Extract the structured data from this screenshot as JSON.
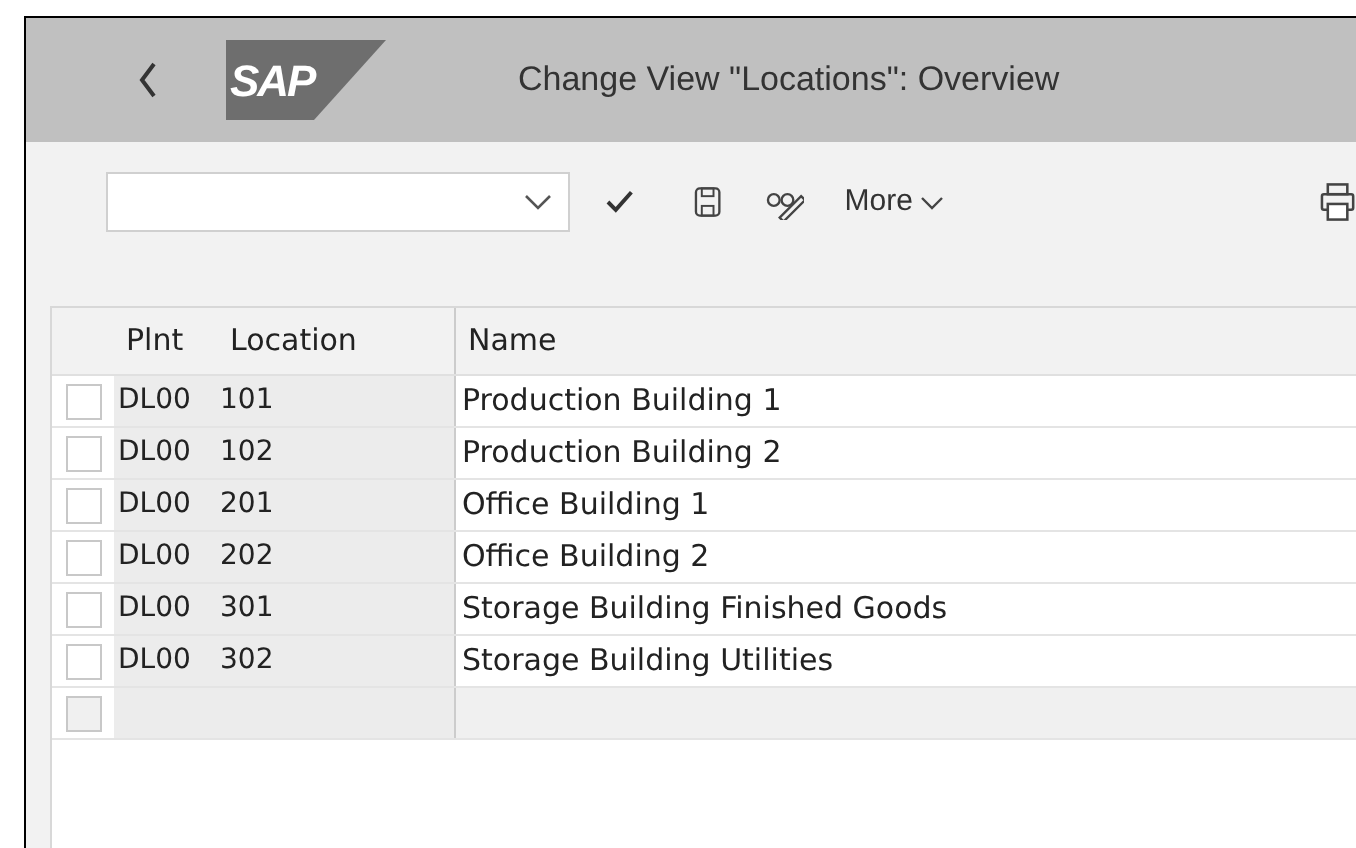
{
  "header": {
    "title": "Change View \"Locations\": Overview",
    "logo": "SAP"
  },
  "toolbar": {
    "more": "More"
  },
  "table": {
    "columns": [
      "Plnt",
      "Location",
      "Name"
    ],
    "rows": [
      {
        "plant": "DL00",
        "location": "101",
        "name": "Production Building 1",
        "checked": false
      },
      {
        "plant": "DL00",
        "location": "102",
        "name": "Production Building 2",
        "checked": false
      },
      {
        "plant": "DL00",
        "location": "201",
        "name": "Office Building 1",
        "checked": false
      },
      {
        "plant": "DL00",
        "location": "202",
        "name": "Office Building 2",
        "checked": false
      },
      {
        "plant": "DL00",
        "location": "301",
        "name": "Storage Building Finished Goods",
        "checked": false
      },
      {
        "plant": "DL00",
        "location": "302",
        "name": "Storage Building Utilities",
        "checked": false
      }
    ],
    "empty_row": {
      "disabled": true
    }
  }
}
